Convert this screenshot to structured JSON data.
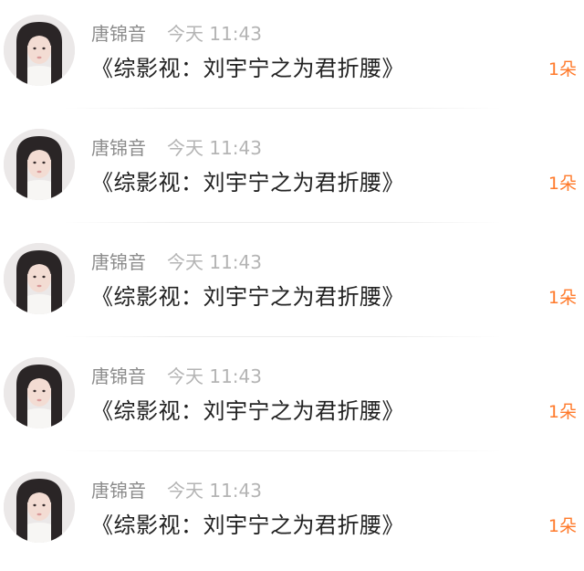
{
  "comments": [
    {
      "avatar": "user-avatar",
      "name": "唐锦音",
      "time": "今天 11:43",
      "message": "《综影视：刘宇宁之为君折腰》",
      "gift": "1朵"
    },
    {
      "avatar": "user-avatar",
      "name": "唐锦音",
      "time": "今天 11:43",
      "message": "《综影视：刘宇宁之为君折腰》",
      "gift": "1朵"
    },
    {
      "avatar": "user-avatar",
      "name": "唐锦音",
      "time": "今天 11:43",
      "message": "《综影视：刘宇宁之为君折腰》",
      "gift": "1朵"
    },
    {
      "avatar": "user-avatar",
      "name": "唐锦音",
      "time": "今天 11:43",
      "message": "《综影视：刘宇宁之为君折腰》",
      "gift": "1朵"
    },
    {
      "avatar": "user-avatar",
      "name": "唐锦音",
      "time": "今天 11:43",
      "message": "《综影视：刘宇宁之为君折腰》",
      "gift": "1朵"
    }
  ],
  "colors": {
    "name": "#8c8c8c",
    "time": "#b4b4b4",
    "message": "#222222",
    "gift": "#ff7a2b"
  }
}
